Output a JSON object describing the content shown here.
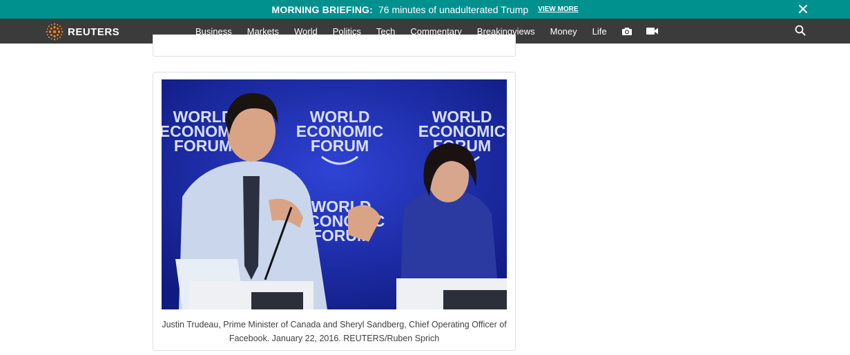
{
  "banner": {
    "label": "MORNING BRIEFING:",
    "text": "76 minutes of unadulterated Trump",
    "link": "VIEW MORE",
    "background": "#00918f"
  },
  "nav": {
    "logo_text": "REUTERS",
    "items": [
      "Business",
      "Markets",
      "World",
      "Politics",
      "Tech",
      "Commentary",
      "Breakingviews",
      "Money",
      "Life"
    ],
    "icons": [
      "camera-icon",
      "video-icon",
      "search-icon"
    ],
    "background": "#3b3b3b"
  },
  "article": {
    "photo": {
      "backdrop_text": [
        "WORLD",
        "ECONOMIC",
        "FORUM"
      ]
    },
    "caption": "Justin Trudeau, Prime Minister of Canada and Sheryl Sandberg, Chief Operating Officer of Facebook. January 22, 2016. REUTERS/Ruben Sprich"
  }
}
